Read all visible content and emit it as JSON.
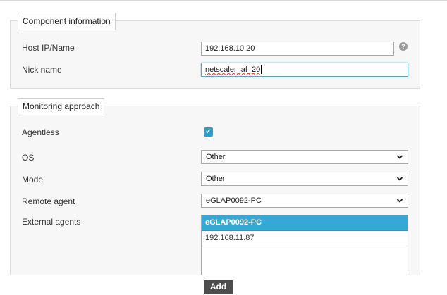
{
  "component_information": {
    "legend": "Component information",
    "host_label": "Host IP/Name",
    "host_value": "192.168.10.20",
    "help_icon": "question-circle-icon",
    "nick_label": "Nick name",
    "nick_value": "netscaler_af_20"
  },
  "monitoring_approach": {
    "legend": "Monitoring approach",
    "agentless_label": "Agentless",
    "agentless_checked": true,
    "os_label": "OS",
    "os_value": "Other",
    "mode_label": "Mode",
    "mode_value": "Other",
    "remote_agent_label": "Remote agent",
    "remote_agent_value": "eGLAP0092-PC",
    "external_agents_label": "External agents",
    "external_agents": [
      {
        "label": "eGLAP0092-PC",
        "selected": true
      },
      {
        "label": "192.168.11.87",
        "selected": false
      }
    ]
  },
  "actions": {
    "add_label": "Add"
  },
  "colors": {
    "accent": "#35a8d6",
    "button": "#4d4d4d"
  }
}
